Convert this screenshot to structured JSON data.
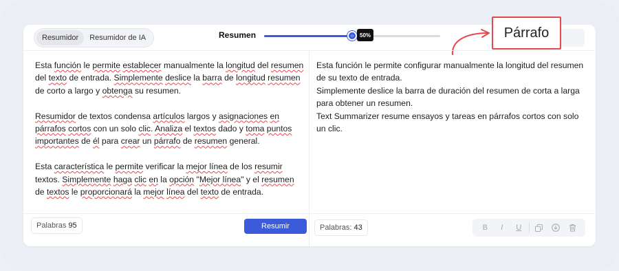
{
  "tabs": {
    "summarizer": "Resumidor",
    "ai_summarizer": "Resumidor de IA"
  },
  "length_control": {
    "label": "Resumen",
    "value_label": "50%",
    "value_fraction": 0.5
  },
  "callout": {
    "label": "Párrafo"
  },
  "input": {
    "paragraphs": [
      {
        "segments": [
          {
            "text": "Esta ",
            "sp": false
          },
          {
            "text": "función",
            "sp": true
          },
          {
            "text": " le ",
            "sp": false
          },
          {
            "text": "permite",
            "sp": true
          },
          {
            "text": " ",
            "sp": false
          },
          {
            "text": "establecer",
            "sp": true
          },
          {
            "text": " manualmente la ",
            "sp": false
          },
          {
            "text": "longitud",
            "sp": true
          },
          {
            "text": " del ",
            "sp": false
          },
          {
            "text": "resumen",
            "sp": true
          },
          {
            "text": " del ",
            "sp": false
          },
          {
            "text": "texto",
            "sp": true
          },
          {
            "text": " de entrada. ",
            "sp": false
          },
          {
            "text": "Simplemente",
            "sp": true
          },
          {
            "text": " ",
            "sp": false
          },
          {
            "text": "deslice",
            "sp": true
          },
          {
            "text": " la ",
            "sp": false
          },
          {
            "text": "barra",
            "sp": true
          },
          {
            "text": " de ",
            "sp": false
          },
          {
            "text": "longitud",
            "sp": true
          },
          {
            "text": " ",
            "sp": false
          },
          {
            "text": "resumen",
            "sp": true
          },
          {
            "text": " de corto a largo y ",
            "sp": false
          },
          {
            "text": "obtenga",
            "sp": true
          },
          {
            "text": " su resumen.",
            "sp": false
          }
        ]
      },
      {
        "segments": [
          {
            "text": "Resumidor",
            "sp": true
          },
          {
            "text": " de textos condensa ",
            "sp": false
          },
          {
            "text": "artículos",
            "sp": true
          },
          {
            "text": " largos y ",
            "sp": false
          },
          {
            "text": "asignaciones",
            "sp": true
          },
          {
            "text": " ",
            "sp": false
          },
          {
            "text": "en",
            "sp": true
          },
          {
            "text": " ",
            "sp": false
          },
          {
            "text": "párrafos",
            "sp": true
          },
          {
            "text": " ",
            "sp": false
          },
          {
            "text": "cortos",
            "sp": true
          },
          {
            "text": " con un solo ",
            "sp": false
          },
          {
            "text": "clic",
            "sp": true
          },
          {
            "text": ". ",
            "sp": false
          },
          {
            "text": "Analiza",
            "sp": true
          },
          {
            "text": " el ",
            "sp": false
          },
          {
            "text": "textos",
            "sp": true
          },
          {
            "text": " dado y ",
            "sp": false
          },
          {
            "text": "toma",
            "sp": true
          },
          {
            "text": " ",
            "sp": false
          },
          {
            "text": "puntos",
            "sp": true
          },
          {
            "text": " ",
            "sp": false
          },
          {
            "text": "importantes",
            "sp": true
          },
          {
            "text": " de ",
            "sp": false
          },
          {
            "text": "él",
            "sp": true
          },
          {
            "text": " para ",
            "sp": false
          },
          {
            "text": "crear",
            "sp": true
          },
          {
            "text": " un ",
            "sp": false
          },
          {
            "text": "párrafo",
            "sp": true
          },
          {
            "text": " de ",
            "sp": false
          },
          {
            "text": "resumen",
            "sp": true
          },
          {
            "text": " general.",
            "sp": false
          }
        ]
      },
      {
        "segments": [
          {
            "text": "Esta ",
            "sp": false
          },
          {
            "text": "característica",
            "sp": true
          },
          {
            "text": " le ",
            "sp": false
          },
          {
            "text": "permite",
            "sp": true
          },
          {
            "text": " verificar la ",
            "sp": false
          },
          {
            "text": "mejor línea",
            "sp": true
          },
          {
            "text": " de los ",
            "sp": false
          },
          {
            "text": "resumir",
            "sp": true
          },
          {
            "text": " textos. ",
            "sp": false
          },
          {
            "text": "Simplemente",
            "sp": true
          },
          {
            "text": " ",
            "sp": false
          },
          {
            "text": "haga",
            "sp": true
          },
          {
            "text": " ",
            "sp": false
          },
          {
            "text": "clic",
            "sp": true
          },
          {
            "text": " ",
            "sp": false
          },
          {
            "text": "en",
            "sp": true
          },
          {
            "text": " la ",
            "sp": false
          },
          {
            "text": "opción",
            "sp": true
          },
          {
            "text": " \"",
            "sp": false
          },
          {
            "text": "Mejor línea",
            "sp": true
          },
          {
            "text": "\" y el ",
            "sp": false
          },
          {
            "text": "resumen",
            "sp": true
          },
          {
            "text": " de ",
            "sp": false
          },
          {
            "text": "textos",
            "sp": true
          },
          {
            "text": " le ",
            "sp": false
          },
          {
            "text": "proporcionará",
            "sp": true
          },
          {
            "text": " la ",
            "sp": false
          },
          {
            "text": "mejor",
            "sp": true
          },
          {
            "text": " ",
            "sp": false
          },
          {
            "text": "línea",
            "sp": true
          },
          {
            "text": " del ",
            "sp": false
          },
          {
            "text": "texto",
            "sp": true
          },
          {
            "text": " de entrada.",
            "sp": false
          }
        ]
      }
    ],
    "word_count_label": "Palabras",
    "word_count": "95",
    "submit_label": "Resumir"
  },
  "output": {
    "lines": [
      "Esta función le permite configurar manualmente la longitud del resumen de su texto de entrada.",
      "Simplemente deslice la barra de duración del resumen de corta a larga para obtener un resumen.",
      "Text Summarizer resume ensayos y tareas en párrafos cortos con solo un clic."
    ],
    "word_count_label": "Palabras:",
    "word_count": "43"
  },
  "toolbar": {
    "bold": "B",
    "italic": "I",
    "underline": "U",
    "icons": [
      "bold-icon",
      "italic-icon",
      "underline-icon",
      "copy-icon",
      "download-icon",
      "trash-icon"
    ]
  },
  "colors": {
    "accent": "#3b5bdb",
    "callout_border": "#e5484d",
    "spell_underline": "#e5484d"
  }
}
